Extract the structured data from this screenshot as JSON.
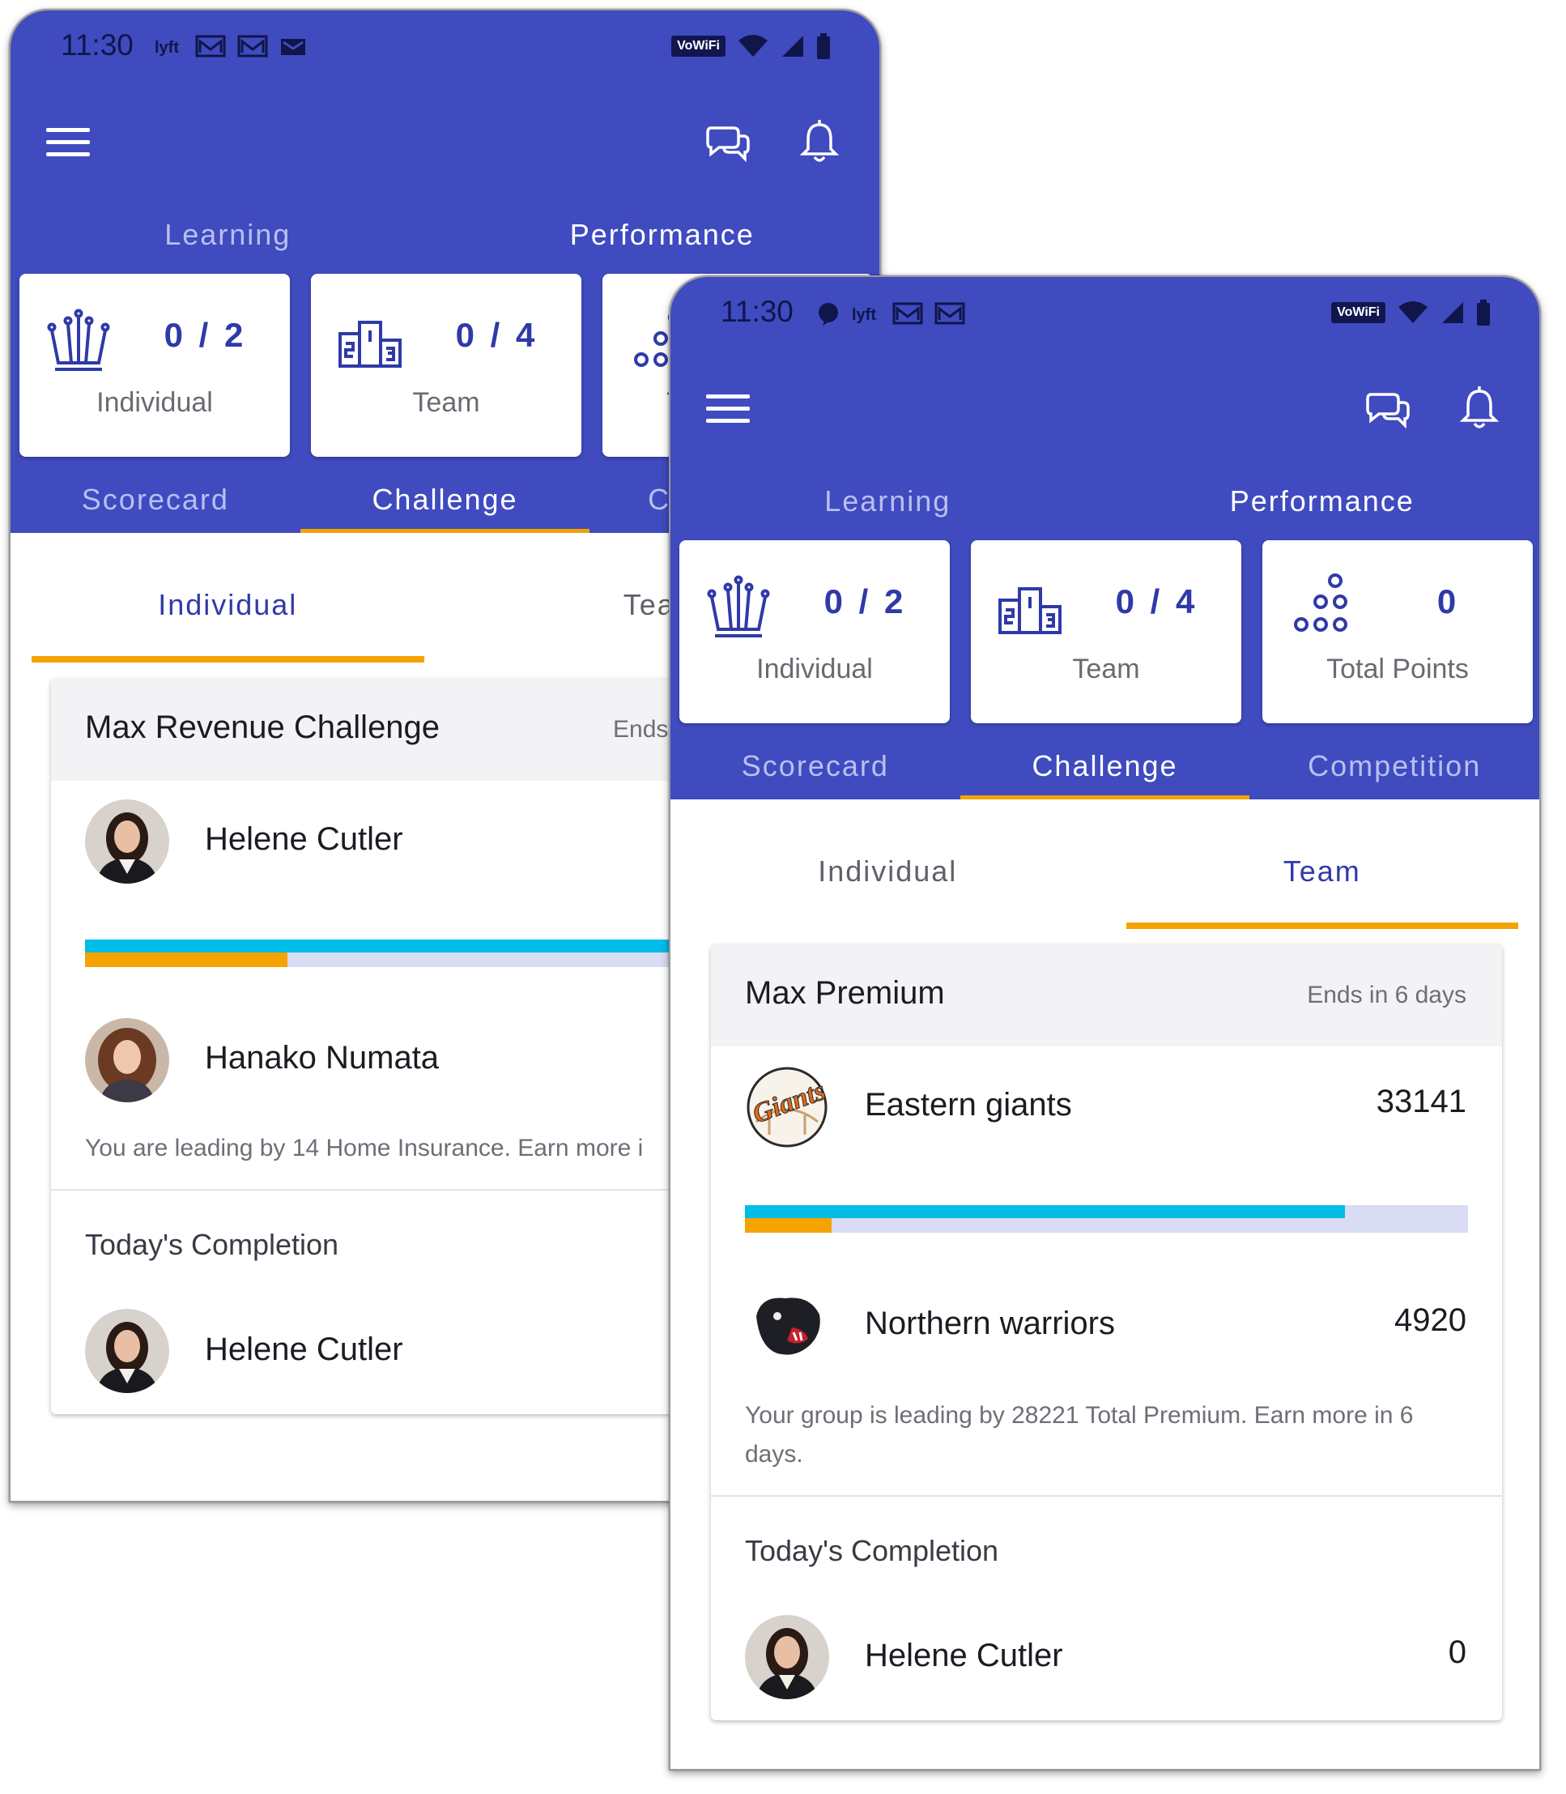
{
  "status": {
    "time": "11:30",
    "vowifi_label": "VoWiFi"
  },
  "top_tabs": [
    "Learning",
    "Performance"
  ],
  "sub_tabs": [
    "Scorecard",
    "Challenge",
    "Competition"
  ],
  "cards": [
    {
      "value": "0 / 2",
      "label": "Individual",
      "icon": "crown-icon"
    },
    {
      "value": "0 / 4",
      "label": "Team",
      "icon": "podium-icon"
    },
    {
      "value": "0",
      "label": "Total Points",
      "icon": "dots-triangle-icon"
    }
  ],
  "segments": [
    "Individual",
    "Team"
  ],
  "colors": {
    "primary": "#3f4bbf",
    "accent": "#f5a300",
    "progress_a": "#00bde8",
    "progress_track": "#d9dcf2"
  },
  "screen_a": {
    "active_top_tab": "Performance",
    "active_sub_tab": "Challenge",
    "active_segment": "Individual",
    "challenge": {
      "title": "Max Revenue Challenge",
      "ends": "Ends",
      "leaders": [
        {
          "name": "Helene Cutler"
        },
        {
          "name": "Hanako Numata"
        }
      ],
      "progress": {
        "bar_a_pct": 100,
        "bar_b_pct": 28
      },
      "lead_text": "You are leading by 14 Home Insurance. Earn more i",
      "completion_title": "Today's Completion",
      "completion_name": "Helene Cutler"
    }
  },
  "screen_b": {
    "active_top_tab": "Performance",
    "active_sub_tab": "Challenge",
    "active_segment": "Team",
    "challenge": {
      "title": "Max Premium",
      "ends": "Ends in 6 days",
      "leaders": [
        {
          "name": "Eastern giants",
          "value": "33141",
          "logo": "giants-logo"
        },
        {
          "name": "Northern warriors",
          "value": "4920",
          "logo": "panther-logo"
        }
      ],
      "progress": {
        "bar_a_pct": 83,
        "bar_b_pct": 12
      },
      "lead_text": "Your group is leading by 28221 Total Premium. Earn more in 6 days.",
      "completion_title": "Today's Completion",
      "completion_name": "Helene Cutler",
      "completion_value": "0"
    }
  }
}
